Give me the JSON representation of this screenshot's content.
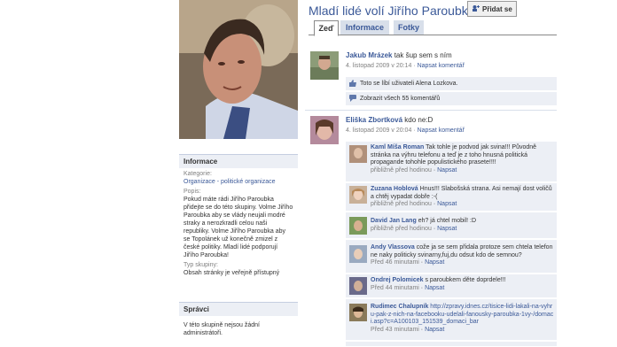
{
  "page": {
    "title": "Mladí lidé volí Jiřího Paroubka!",
    "add_button": "Přidat se"
  },
  "tabs": [
    {
      "label": "Zeď",
      "active": true
    },
    {
      "label": "Informace",
      "active": false
    },
    {
      "label": "Fotky",
      "active": false
    }
  ],
  "info": {
    "header": "Informace",
    "category_label": "Kategorie:",
    "category_value": "Organizace - politické organizace",
    "desc_label": "Popis:",
    "desc_value": "Pokud máte rádi Jiřího Paroubka přidejte se do této skupiny. Volme Jiřího Paroubka aby se vlády neujali modré straky a nerozkradli celou naši republiky. Volme Jiřího Paroubka aby se Topolánek už konečně zmizel z české politiky. Mladí lidé podporují Jiřího Paroubka!",
    "type_label": "Typ skupiny:",
    "type_value": "Obsah stránky je veřejně přístupný"
  },
  "admins": {
    "header": "Správci",
    "text": "V této skupině nejsou žádní administrátoři."
  },
  "posts": [
    {
      "author": "Jakub Mrázek",
      "text": "tak šup sem s ním",
      "time": "4. listopad 2009 v 20:14",
      "action": "Napsat komentář",
      "like_text": "Toto se líbí uživateli Alena Lozkova.",
      "view_comments": "Zobrazit všech 55 komentářů"
    },
    {
      "author": "Eliška Zbortková",
      "text": "kdo ne:D",
      "time": "4. listopad 2009 v 20:04",
      "action": "Napsat komentář"
    }
  ],
  "comments": [
    {
      "author": "Kaml Míša Roman",
      "text": "Tak tohle je podvod jak svina!!! Původně stránka na výhru telefonu a teď je z toho hnusná politická propagande tohohle populistického prasete!!!!",
      "time": "přibližně před hodinou",
      "action": "Napsat"
    },
    {
      "author": "Zuzana Hoblová",
      "text": "Hnus!!! Slabošská strana. Asi nemají dost voličů a chtěj vypadat dobře :-(",
      "time": "přibližně před hodinou",
      "action": "Napsat"
    },
    {
      "author": "David Jan Lang",
      "text": "eh? já chtel mobil! :D",
      "time": "přibližně před hodinou",
      "action": "Napsat"
    },
    {
      "author": "Andy Vlassova",
      "text": "cože ja se sem přidala protoze sem chtela telefon ne naky politicky svinarny,fuj,du odsut kdo de semnou?",
      "time": "Před 46 minutami",
      "action": "Napsat"
    },
    {
      "author": "Ondrej Polomicek",
      "text": "s paroubkem děte doprdele!!!",
      "time": "Před 44 minutami",
      "action": "Napsat"
    },
    {
      "author": "Rudimec Chalupník",
      "text": "http://zpravy.idnes.cz/tisice-lidi-lakali-na-vyhru-pak-z-nich-na-facebooku-udelali-fanousky-paroubka-1vy-/domaci.asp?c=A100103_151539_domaci_bar",
      "time": "Před 43 minutami",
      "action": "Napsat"
    }
  ]
}
